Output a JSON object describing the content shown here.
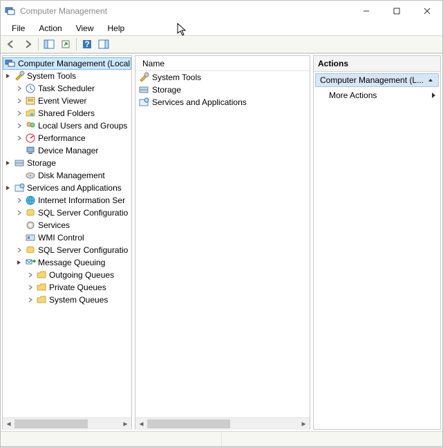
{
  "window": {
    "title": "Computer Management"
  },
  "menu": {
    "file": "File",
    "action": "Action",
    "view": "View",
    "help": "Help"
  },
  "tree": {
    "root": "Computer Management (Local",
    "system_tools": "System Tools",
    "task_scheduler": "Task Scheduler",
    "event_viewer": "Event Viewer",
    "shared_folders": "Shared Folders",
    "local_users": "Local Users and Groups",
    "performance": "Performance",
    "device_manager": "Device Manager",
    "storage": "Storage",
    "disk_management": "Disk Management",
    "services_apps": "Services and Applications",
    "iis": "Internet Information Ser",
    "sqlconfig1": "SQL Server Configuratio",
    "services": "Services",
    "wmi": "WMI Control",
    "sqlconfig2": "SQL Server Configuratio",
    "msmq": "Message Queuing",
    "outgoing": "Outgoing Queues",
    "private": "Private Queues",
    "system_queues": "System Queues"
  },
  "list": {
    "header_name": "Name",
    "items": {
      "system_tools": "System Tools",
      "storage": "Storage",
      "services_apps": "Services and Applications"
    }
  },
  "actions": {
    "header": "Actions",
    "group": "Computer Management (L...",
    "more": "More Actions"
  }
}
